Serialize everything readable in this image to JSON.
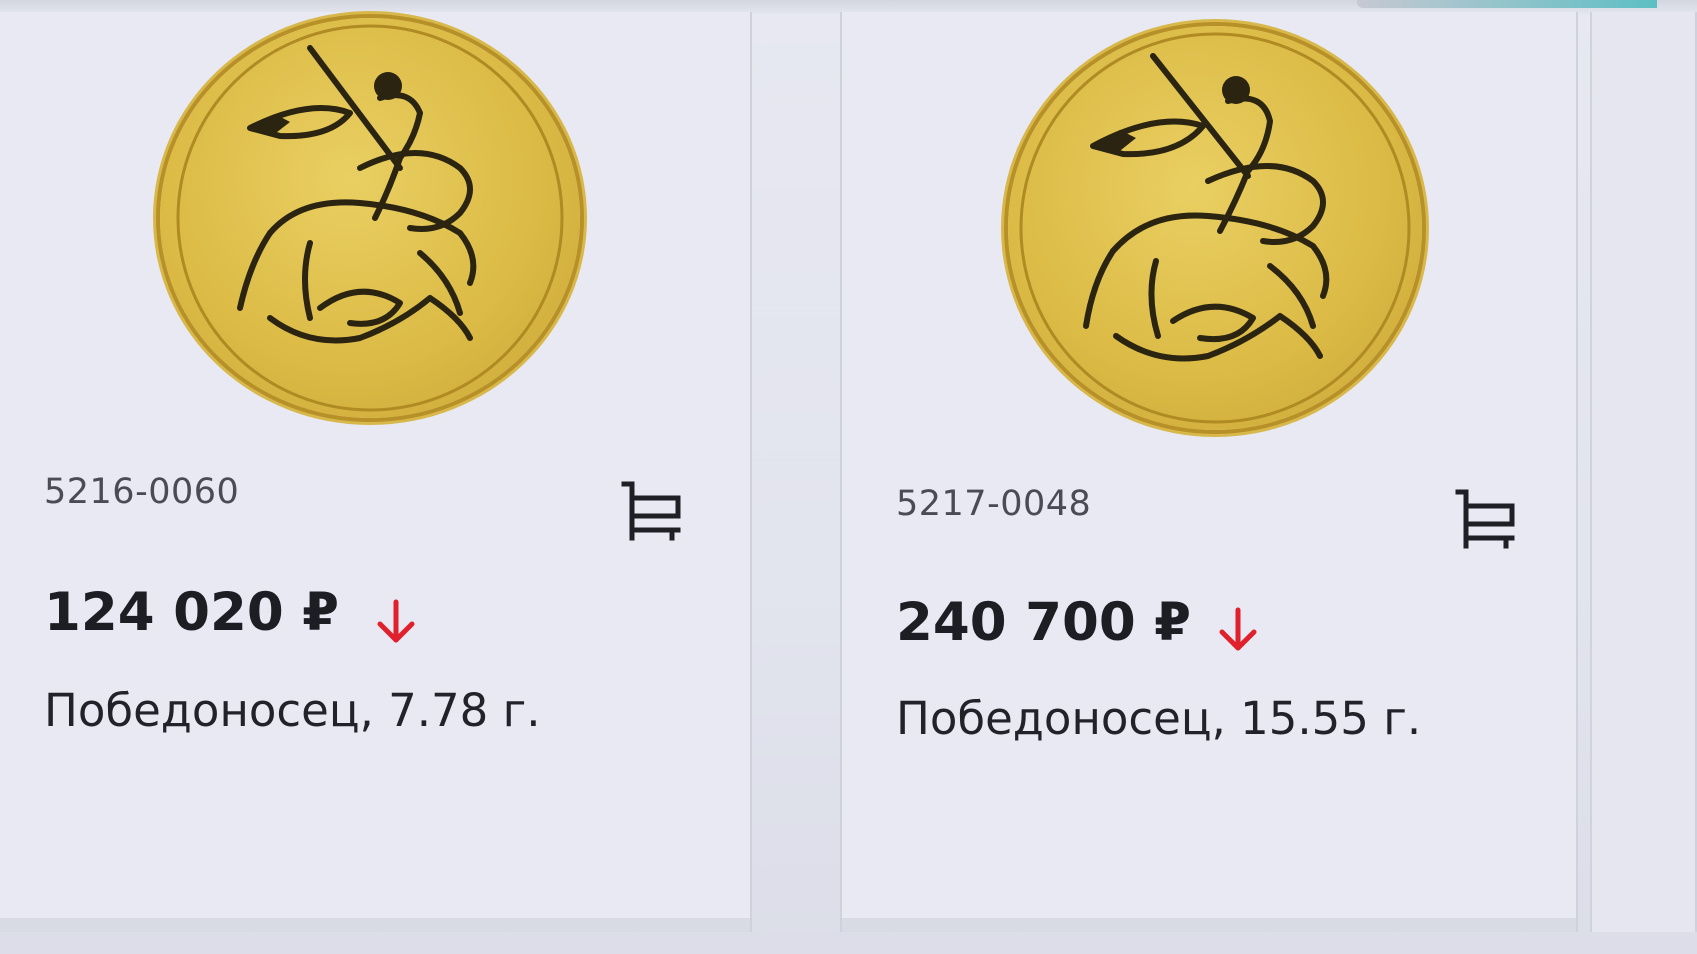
{
  "products": [
    {
      "sku": "5216-0060",
      "price": "124 020 ₽",
      "title": "Победоносец, 7.78 г.",
      "price_trend_icon": "arrow-down-icon",
      "cart_icon": "cart-icon"
    },
    {
      "sku": "5217-0048",
      "price": "240 700 ₽",
      "title": "Победоносец, 15.55 г.",
      "price_trend_icon": "arrow-down-icon",
      "cart_icon": "cart-icon"
    }
  ],
  "colors": {
    "price_down": "#e0202c",
    "gold": "#dcbb46",
    "card_bg": "#e8e9f2"
  }
}
